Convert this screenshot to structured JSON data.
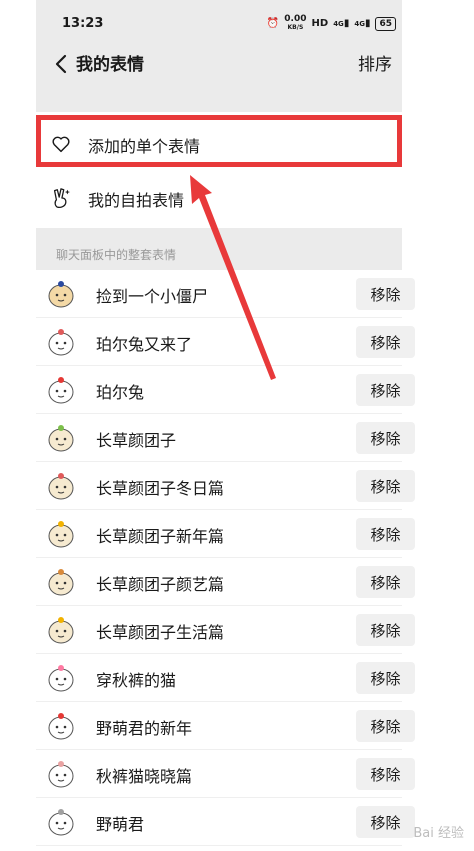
{
  "status_bar": {
    "time": "13:23",
    "speed": "0.00",
    "speed_unit": "KB/S",
    "hd": "HD",
    "signal1": "4G",
    "signal2": "4G",
    "battery": "65"
  },
  "header": {
    "title": "我的表情",
    "sort_label": "排序"
  },
  "menu": {
    "added_single": "添加的单个表情",
    "selfie": "我的自拍表情"
  },
  "section": {
    "title": "聊天面板中的整套表情"
  },
  "packs": [
    {
      "name": "捡到一个小僵尸",
      "action": "移除"
    },
    {
      "name": "珀尔兔又来了",
      "action": "移除"
    },
    {
      "name": "珀尔兔",
      "action": "移除"
    },
    {
      "name": "长草颜团子",
      "action": "移除"
    },
    {
      "name": "长草颜团子冬日篇",
      "action": "移除"
    },
    {
      "name": "长草颜团子新年篇",
      "action": "移除"
    },
    {
      "name": "长草颜团子颜艺篇",
      "action": "移除"
    },
    {
      "name": "长草颜团子生活篇",
      "action": "移除"
    },
    {
      "name": "穿秋裤的猫",
      "action": "移除"
    },
    {
      "name": "野萌君的新年",
      "action": "移除"
    },
    {
      "name": "秋裤猫晓晓篇",
      "action": "移除"
    },
    {
      "name": "野萌君",
      "action": "移除"
    }
  ],
  "watermark": "Bai 经验",
  "colors": {
    "highlight": "#e8393a",
    "header_bg": "#ebebeb",
    "button_bg": "#f0f0f0"
  }
}
